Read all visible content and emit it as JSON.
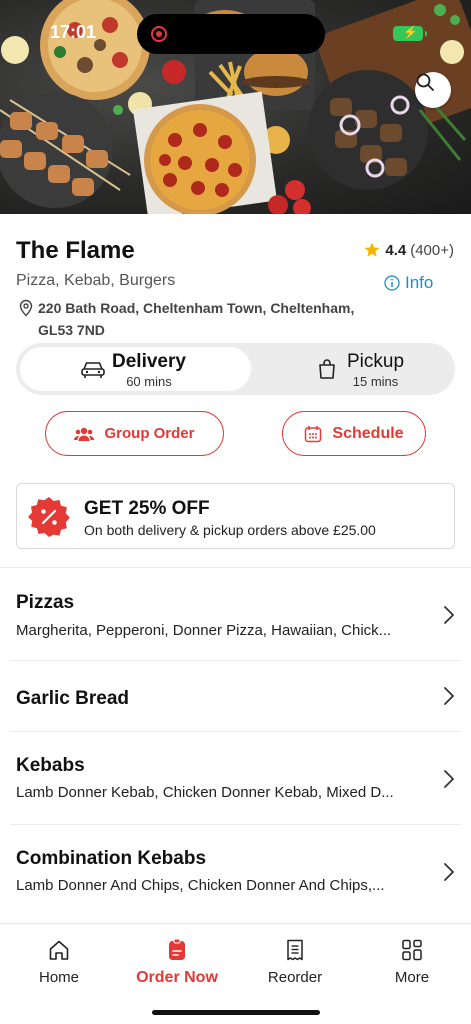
{
  "status_bar": {
    "time": "17:01"
  },
  "restaurant": {
    "name": "The Flame",
    "rating": "4.4",
    "rating_count": "(400+)",
    "cuisine": "Pizza, Kebab, Burgers",
    "info_label": "Info",
    "address": "220 Bath Road, Cheltenham Town, Cheltenham, GL53 7ND"
  },
  "order_mode": {
    "selected": "Delivery",
    "delivery": {
      "label": "Delivery",
      "time": "60 mins"
    },
    "pickup": {
      "label": "Pickup",
      "time": "15 mins"
    }
  },
  "actions": {
    "group_order": "Group Order",
    "schedule": "Schedule"
  },
  "promo": {
    "title": "GET 25% OFF",
    "subtitle": "On both delivery & pickup orders above £25.00"
  },
  "categories": [
    {
      "title": "Pizzas",
      "desc": "Margherita, Pepperoni, Donner Pizza, Hawaiian, Chick..."
    },
    {
      "title": "Garlic Bread",
      "desc": ""
    },
    {
      "title": "Kebabs",
      "desc": "Lamb Donner Kebab, Chicken Donner Kebab, Mixed D..."
    },
    {
      "title": "Combination Kebabs",
      "desc": "Lamb Donner And Chips, Chicken Donner And Chips,..."
    }
  ],
  "bottom_nav": [
    {
      "label": "Home",
      "icon": "home-icon"
    },
    {
      "label": "Order Now",
      "icon": "order-now-icon",
      "active": true
    },
    {
      "label": "Reorder",
      "icon": "receipt-icon"
    },
    {
      "label": "More",
      "icon": "grid-icon"
    }
  ],
  "colors": {
    "accent": "#e53935",
    "link": "#1c8fc9",
    "star": "#f5b400",
    "battery": "#34c759"
  }
}
